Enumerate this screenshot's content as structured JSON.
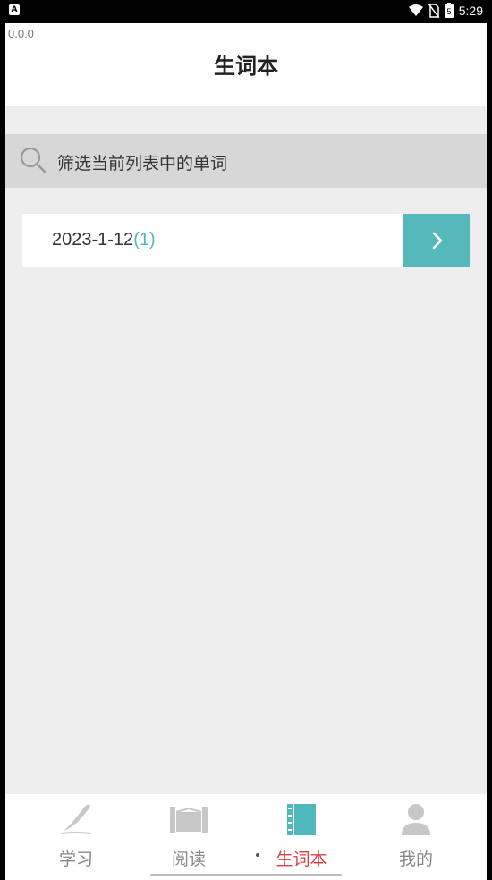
{
  "status_bar": {
    "time": "5:29",
    "battery_level": "5"
  },
  "version_label": "0.0.0",
  "header": {
    "title": "生词本"
  },
  "search": {
    "placeholder": "筛选当前列表中的单词"
  },
  "word_lists": [
    {
      "date": "2023-1-12",
      "count": "(1)"
    }
  ],
  "tabs": [
    {
      "label": "学习",
      "icon": "pen-icon",
      "active": false
    },
    {
      "label": "阅读",
      "icon": "book-open-icon",
      "active": false
    },
    {
      "label": "生词本",
      "icon": "notebook-icon",
      "active": true
    },
    {
      "label": "我的",
      "icon": "person-icon",
      "active": false
    }
  ],
  "colors": {
    "accent_teal": "#55b9bb",
    "active_tab_red": "#d94040",
    "background": "#eeeeee"
  }
}
